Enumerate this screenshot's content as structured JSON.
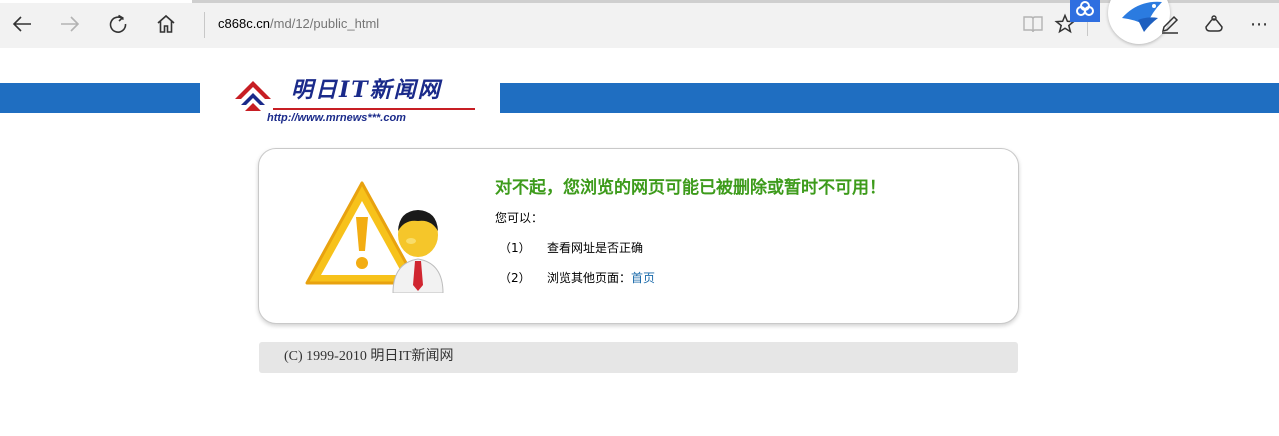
{
  "browser": {
    "address": {
      "host": "c868c.cn",
      "path": "/md/12/public_html"
    },
    "icons": {
      "back": "back-arrow-icon",
      "forward": "forward-arrow-icon",
      "refresh": "refresh-icon",
      "home": "home-icon",
      "reading_view": "reading-view-icon",
      "favorite": "star-icon",
      "baidu_ext": "baidu-cloud-icon",
      "bird_ext": "bird-extension-icon",
      "notes": "pen-icon",
      "share": "share-icon",
      "more": "more-icon"
    },
    "more_label": "⋯"
  },
  "header": {
    "logo_title": "明日IT新闻网",
    "logo_url": "http://www.mrnews***.com",
    "band_color": "#1f6ec1"
  },
  "error": {
    "title": "对不起，您浏览的网页可能已被删除或暂时不可用！",
    "intro": "您可以：",
    "items": [
      {
        "num": "（1）",
        "text": "查看网址是否正确",
        "link": ""
      },
      {
        "num": "（2）",
        "text": "浏览其他页面：",
        "link": "首页"
      }
    ],
    "title_color": "#3d9b1b",
    "link_color": "#1a6aaa"
  },
  "footer": {
    "copyright": "(C)   1999-2010 明日IT新闻网"
  }
}
